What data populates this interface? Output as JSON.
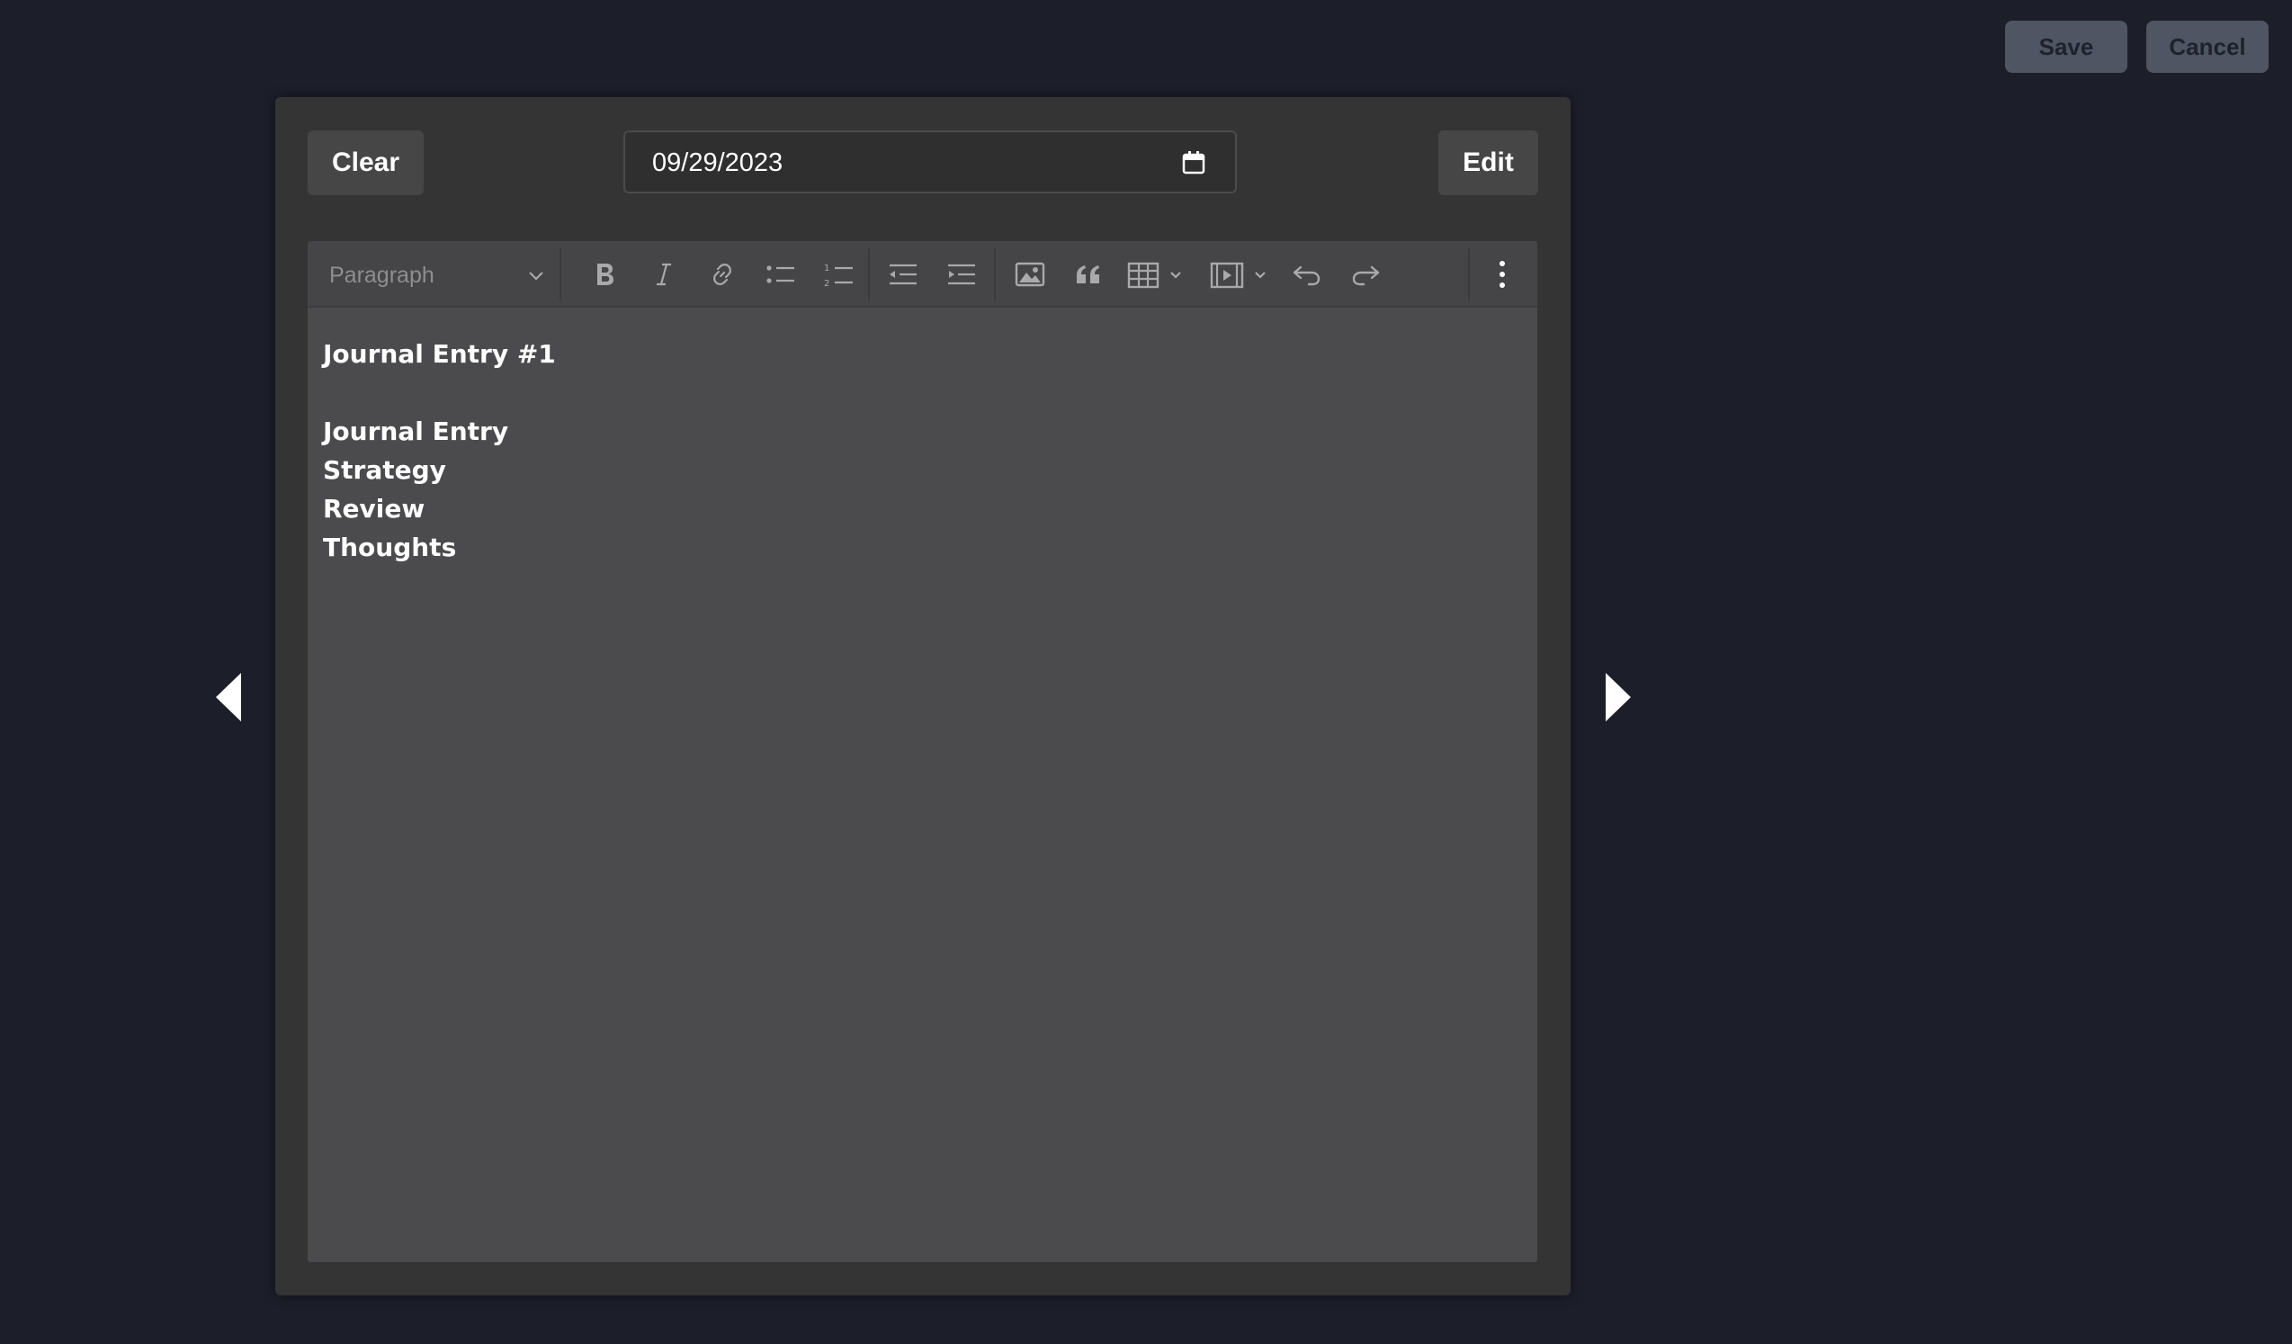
{
  "header": {
    "save_label": "Save",
    "cancel_label": "Cancel"
  },
  "modal": {
    "clear_label": "Clear",
    "edit_label": "Edit",
    "date_value": "09/29/2023"
  },
  "toolbar": {
    "format_value": "Paragraph",
    "tools": [
      "bold-icon",
      "italic-icon",
      "link-icon",
      "bulleted-list-icon",
      "numbered-list-icon",
      "outdent-icon",
      "indent-icon",
      "image-icon",
      "blockquote-icon",
      "table-icon",
      "media-icon",
      "undo-icon",
      "redo-icon",
      "more-options-icon"
    ]
  },
  "document": {
    "title": "Journal Entry #1",
    "lines": [
      "Journal Entry",
      "Strategy",
      "Review",
      "Thoughts"
    ]
  },
  "colors": {
    "page_bg": "#1c1f2a",
    "modal_bg": "#343434",
    "editor_bg": "#4b4b4d",
    "toolbar_bg": "#454547",
    "top_button_bg": "#4f5563"
  }
}
